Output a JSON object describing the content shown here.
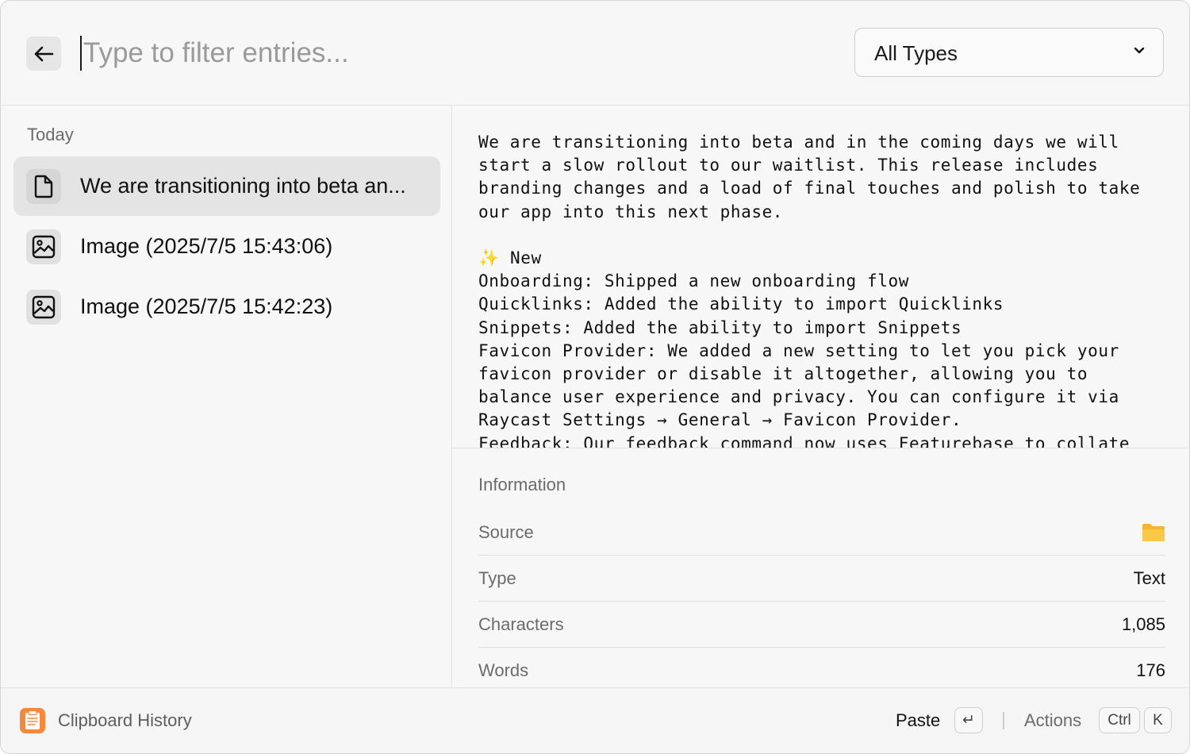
{
  "search": {
    "placeholder": "Type to filter entries...",
    "value": ""
  },
  "filter": {
    "selected": "All Types"
  },
  "list": {
    "section_title": "Today",
    "items": [
      {
        "label": "We are transitioning into beta an...",
        "icon": "document-icon",
        "selected": true
      },
      {
        "label": "Image (2025/7/5 15:43:06)",
        "icon": "image-icon",
        "selected": false
      },
      {
        "label": "Image (2025/7/5 15:42:23)",
        "icon": "image-icon",
        "selected": false
      }
    ]
  },
  "preview": {
    "text": "We are transitioning into beta and in the coming days we will\nstart a slow rollout to our waitlist. This release includes\nbranding changes and a load of final touches and polish to take\nour app into this next phase.\n\n✨ New\nOnboarding: Shipped a new onboarding flow\nQuicklinks: Added the ability to import Quicklinks\nSnippets: Added the ability to import Snippets\nFavicon Provider: We added a new setting to let you pick your\nfavicon provider or disable it altogether, allowing you to\nbalance user experience and privacy. You can configure it via\nRaycast Settings → General → Favicon Provider.\nFeedback: Our feedback command now uses Featurebase to collate"
  },
  "information": {
    "title": "Information",
    "source_label": "Source",
    "source_icon": "folder-icon",
    "type_label": "Type",
    "type_value": "Text",
    "characters_label": "Characters",
    "characters_value": "1,085",
    "words_label": "Words",
    "words_value": "176"
  },
  "footer": {
    "app_name": "Clipboard History",
    "primary_action": "Paste",
    "primary_key": "↵",
    "secondary_action": "Actions",
    "secondary_key_1": "Ctrl",
    "secondary_key_2": "K"
  },
  "colors": {
    "accent_orange": "#F5883A",
    "folder_yellow": "#F9C846",
    "selected_bg": "#E4E4E4"
  }
}
